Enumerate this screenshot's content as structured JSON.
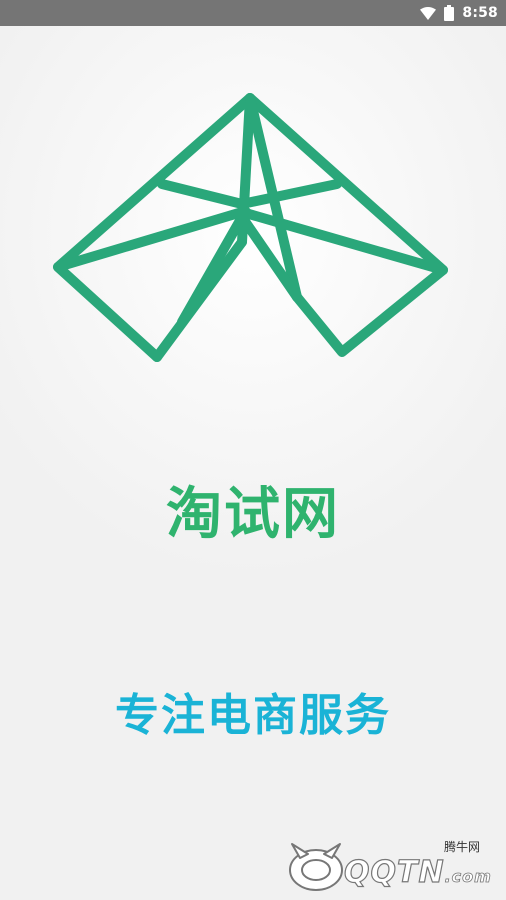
{
  "status_bar": {
    "time": "8:58",
    "icons": [
      "wifi-icon",
      "battery-icon"
    ]
  },
  "splash": {
    "logo_icon": "taoshi-logo-icon",
    "app_name": "淘试网",
    "tagline": "专注电商服务"
  },
  "watermark": {
    "site_name": "腾牛网",
    "domain_main": "QQTN",
    "domain_suffix": ".com"
  },
  "colors": {
    "status_bar": "#757575",
    "logo_green": "#2aa77a",
    "app_name": "#2fb36e",
    "tagline": "#1ab3d6",
    "background": "#f2f2f2"
  }
}
